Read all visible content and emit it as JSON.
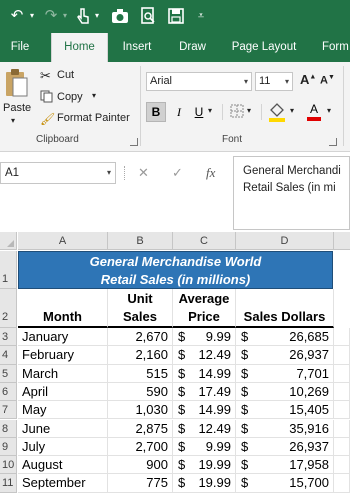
{
  "qat": {
    "undo_icon": "undo-icon",
    "redo_icon": "redo-icon",
    "touch_icon": "touch-mode-icon",
    "camera_icon": "camera-icon",
    "print_preview_icon": "print-preview-icon",
    "save_icon": "save-icon",
    "customize_icon": "customize-qat-icon"
  },
  "tabs": [
    "File",
    "Home",
    "Insert",
    "Draw",
    "Page Layout",
    "Form"
  ],
  "active_tab": "Home",
  "ribbon": {
    "clipboard": {
      "paste_label": "Paste",
      "cut_label": "Cut",
      "copy_label": "Copy",
      "format_painter_label": "Format Painter",
      "group_label": "Clipboard"
    },
    "font": {
      "font_name": "Arial",
      "font_size": "11",
      "bold": "B",
      "italic": "I",
      "underline": "U",
      "grow": "A",
      "shrink": "A",
      "font_color_label": "A",
      "group_label": "Font"
    }
  },
  "formula_bar": {
    "name_box": "A1",
    "cancel": "✕",
    "enter": "✓",
    "fx": "fx",
    "content_line1": "General Merchandi",
    "content_line2": "Retail Sales (in mi"
  },
  "grid": {
    "columns": [
      "A",
      "B",
      "C",
      "D"
    ],
    "title_line1": "General Merchandise World",
    "title_line2": "Retail Sales (in millions)",
    "header_row1": {
      "b": "Unit",
      "c": "Average",
      "d": ""
    },
    "header_row2": {
      "a": "Month",
      "b": "Sales",
      "c": "Price",
      "d": "Sales Dollars"
    },
    "rows": [
      {
        "num": "3",
        "month": "January",
        "units": "2,670",
        "price": "9.99",
        "dollars": "26,685"
      },
      {
        "num": "4",
        "month": "February",
        "units": "2,160",
        "price": "12.49",
        "dollars": "26,937"
      },
      {
        "num": "5",
        "month": "March",
        "units": "515",
        "price": "14.99",
        "dollars": "7,701"
      },
      {
        "num": "6",
        "month": "April",
        "units": "590",
        "price": "17.49",
        "dollars": "10,269"
      },
      {
        "num": "7",
        "month": "May",
        "units": "1,030",
        "price": "14.99",
        "dollars": "15,405"
      },
      {
        "num": "8",
        "month": "June",
        "units": "2,875",
        "price": "12.49",
        "dollars": "35,916"
      },
      {
        "num": "9",
        "month": "July",
        "units": "2,700",
        "price": "9.99",
        "dollars": "26,937"
      },
      {
        "num": "10",
        "month": "August",
        "units": "900",
        "price": "19.99",
        "dollars": "17,958"
      },
      {
        "num": "11",
        "month": "September",
        "units": "775",
        "price": "19.99",
        "dollars": "15,700"
      }
    ],
    "currency": "$",
    "row_labels_top": [
      "1",
      "2"
    ]
  },
  "colors": {
    "excel_green": "#217346",
    "title_fill": "#2e75b6"
  }
}
